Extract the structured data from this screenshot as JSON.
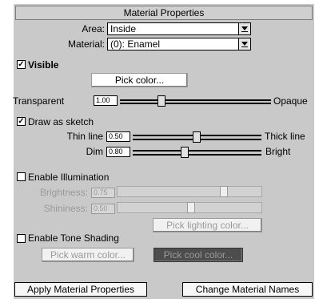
{
  "window": {
    "title": "Material Properties"
  },
  "area": {
    "label": "Area:",
    "value": "Inside"
  },
  "material": {
    "label": "Material:",
    "value": "(0): Enamel"
  },
  "visible": {
    "label": "Visible",
    "checked": true
  },
  "pick_color": {
    "label": "Pick color..."
  },
  "transparency": {
    "left_label": "Transparent",
    "right_label": "Opaque",
    "value": "1.00",
    "fraction": 0.18
  },
  "sketch": {
    "label": "Draw as sketch",
    "checked": true
  },
  "thin_line": {
    "left_label": "Thin line",
    "right_label": "Thick line",
    "value": "0.50",
    "fraction": 0.5
  },
  "dim": {
    "left_label": "Dim",
    "right_label": "Bright",
    "value": "0.80",
    "fraction": 0.4
  },
  "illumination": {
    "label": "Enable Illumination",
    "checked": false
  },
  "brightness": {
    "label": "Brightness:",
    "value": "0.75",
    "fraction": 0.75
  },
  "shininess": {
    "label": "Shininess:",
    "value": "0.50",
    "fraction": 0.5
  },
  "pick_lighting": {
    "label": "Pick lighting color..."
  },
  "tone_shading": {
    "label": "Enable Tone Shading",
    "checked": false
  },
  "pick_warm": {
    "label": "Pick warm color..."
  },
  "pick_cool": {
    "label": "Pick cool color..."
  },
  "footer": {
    "apply_label": "Apply Material Properties",
    "change_names_label": "Change Material Names"
  },
  "colors": {
    "panel": "#c9c9c9",
    "disabled_text": "#9a9a9a",
    "cool_button": "#4d4d4d"
  },
  "icons": {
    "checkbox_checked": "check-mark",
    "dropdown": "chevron-down"
  }
}
